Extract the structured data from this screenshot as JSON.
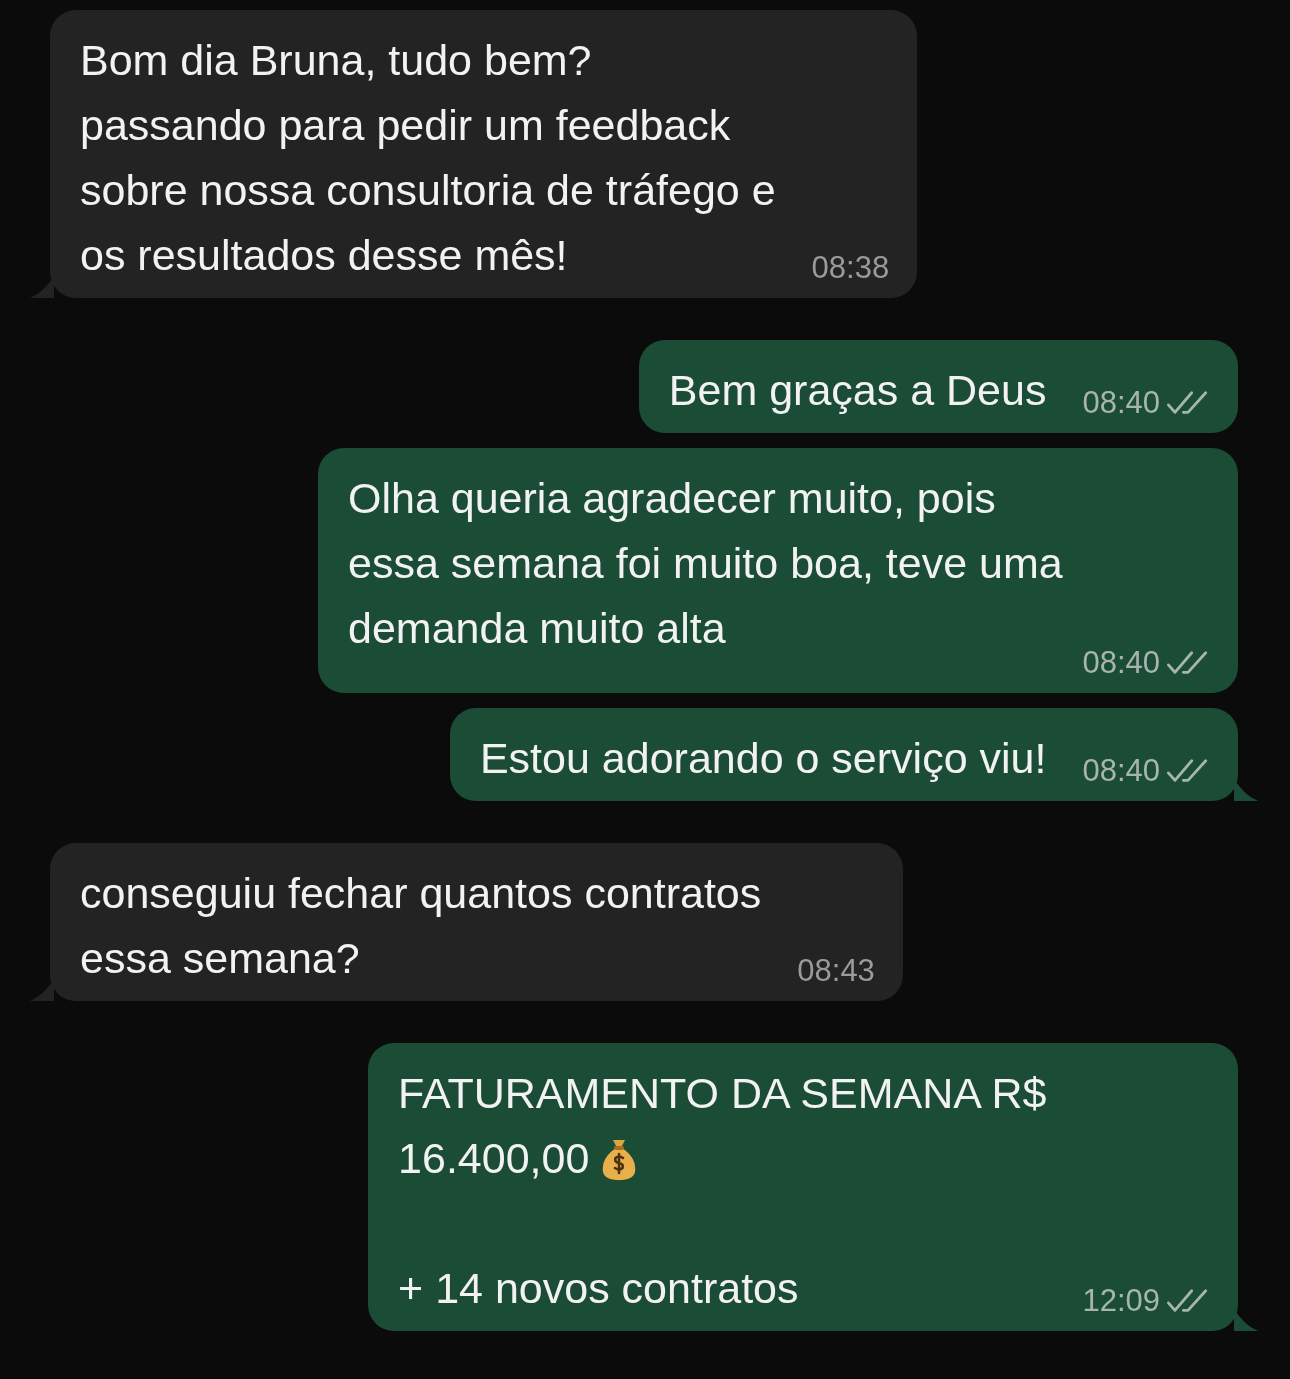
{
  "messages": [
    {
      "kind": "incoming",
      "text": "Bom dia Bruna, tudo bem?\npassando para pedir um feedback\nsobre nossa consultoria de tráfego e\nos resultados desse mês!",
      "time": "08:38",
      "tail": true
    },
    {
      "kind": "outgoing",
      "text": "Bem graças a Deus",
      "time": "08:40",
      "read": false,
      "tail": false
    },
    {
      "kind": "outgoing",
      "text": "Olha queria agradecer muito, pois\nessa semana foi muito boa, teve uma\ndemanda muito alta",
      "time": "08:40",
      "read": false,
      "tail": false
    },
    {
      "kind": "outgoing",
      "text": "Estou adorando o serviço viu!",
      "time": "08:40",
      "read": false,
      "tail": true
    },
    {
      "kind": "incoming",
      "text": "conseguiu fechar quantos contratos\nessa semana?",
      "time": "08:43",
      "tail": true
    },
    {
      "kind": "summary",
      "text": "FATURAMENTO DA SEMANA R$",
      "amount": "16.400,00",
      "after": "+ 14 novos contratos",
      "time": "12:09",
      "read": false,
      "tail": true
    }
  ]
}
